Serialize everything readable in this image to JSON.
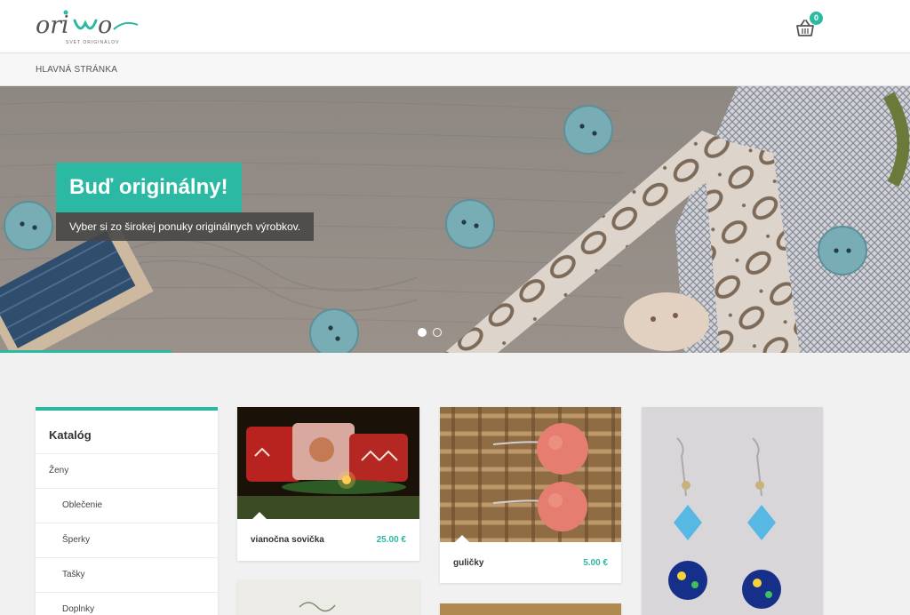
{
  "brand": {
    "logo_text": "oriwo",
    "tagline": "SVET ORIGINÁLOV",
    "accent_color": "#2bb9a3"
  },
  "header": {
    "cart_icon": "basket-icon",
    "cart_count": "0"
  },
  "breadcrumb": {
    "home_label": "HLAVNÁ STRÁNKA"
  },
  "hero": {
    "title": "Buď originálny!",
    "subtitle": "Vyber si zo širokej ponuky originálnych výrobkov.",
    "slide_count": 2,
    "active_slide": 1
  },
  "catalog": {
    "title": "Katalóg",
    "items": [
      {
        "label": "Ženy"
      },
      {
        "label": "Oblečenie"
      },
      {
        "label": "Šperky"
      },
      {
        "label": "Tašky"
      },
      {
        "label": "Doplnky"
      }
    ]
  },
  "products": [
    {
      "name": "vianočna sovička",
      "price": "25.00 €"
    },
    {
      "name": "guličky",
      "price": "5.00 €"
    },
    {
      "name": "",
      "price": ""
    }
  ]
}
